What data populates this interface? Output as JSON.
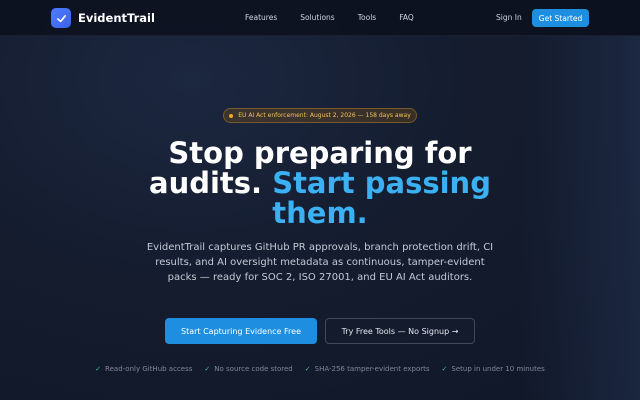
{
  "nav": {
    "brand": "EvidentTrail",
    "links": [
      "Features",
      "Solutions",
      "Tools",
      "FAQ"
    ],
    "sign_in": "Sign In",
    "cta": "Get Started"
  },
  "hero": {
    "badge": "EU AI Act enforcement: August 2, 2026 — 158 days away",
    "headline_part1": "Stop preparing for audits.",
    "headline_accent": "Start passing them.",
    "subtitle": "EvidentTrail captures GitHub PR approvals, branch protection drift, CI results, and AI oversight metadata as continuous, tamper-evident packs — ready for SOC 2, ISO 27001, and EU AI Act auditors.",
    "primary_cta": "Start Capturing Evidence Free",
    "secondary_cta": "Try Free Tools — No Signup →"
  },
  "features": [
    "Read-only GitHub access",
    "No source code stored",
    "SHA-256 tamper-evident exports",
    "Setup in under 10 minutes"
  ],
  "icons": {
    "logo": "checkmark-icon",
    "feature": "check-icon",
    "badge_dot": "status-dot-icon"
  },
  "colors": {
    "accent": "#3bb0f2",
    "primary_button": "#1e8fe0",
    "badge_text": "#f2c25a",
    "check": "#3fbf7f"
  }
}
